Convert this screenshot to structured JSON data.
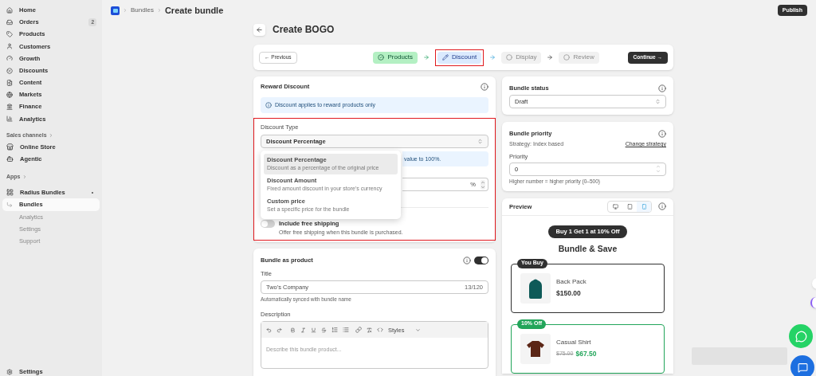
{
  "topbar": {
    "breadcrumb": [
      "Bundles",
      "Create bundle"
    ],
    "publish": "Publish"
  },
  "sidebar": {
    "nav": [
      {
        "label": "Home"
      },
      {
        "label": "Orders",
        "badge": "2"
      },
      {
        "label": "Products"
      },
      {
        "label": "Customers"
      },
      {
        "label": "Growth"
      },
      {
        "label": "Discounts"
      },
      {
        "label": "Content"
      },
      {
        "label": "Markets"
      },
      {
        "label": "Finance"
      },
      {
        "label": "Analytics"
      }
    ],
    "sales_channels": {
      "heading": "Sales channels",
      "items": [
        {
          "label": "Online Store"
        },
        {
          "label": "Agentic"
        }
      ]
    },
    "apps": {
      "heading": "Apps",
      "app": "Radius Bundles",
      "items": [
        {
          "label": "Bundles",
          "selected": true
        },
        {
          "label": "Analytics",
          "selected": false
        },
        {
          "label": "Settings",
          "selected": false
        },
        {
          "label": "Support",
          "selected": false
        }
      ]
    },
    "footer": "Settings"
  },
  "page": {
    "title": "Create BOGO",
    "previous": "← Previous",
    "continue": "Continue →",
    "steps": [
      {
        "label": "Products",
        "done": true,
        "selected": false
      },
      {
        "label": "Discount",
        "done": false,
        "selected": true
      },
      {
        "label": "Display",
        "done": false,
        "selected": false
      },
      {
        "label": "Review",
        "done": false,
        "selected": false
      }
    ]
  },
  "reward": {
    "title": "Reward Discount",
    "info": "Discount applies to reward products only",
    "type_label": "Discount Type",
    "type_value": "Discount Percentage",
    "hint_fragment": "value to 100%.",
    "unit": "%",
    "shipping": {
      "label": "Include free shipping",
      "description": "Offer free shipping when this bundle is purchased.",
      "on": false
    },
    "options": [
      {
        "title": "Discount Percentage",
        "description": "Discount as a percentage of the original price",
        "selected": true
      },
      {
        "title": "Discount Amount",
        "description": "Fixed amount discount in your store's currency",
        "selected": false
      },
      {
        "title": "Custom price",
        "description": "Set a specific price for the bundle",
        "selected": false
      }
    ]
  },
  "bundle_product": {
    "title": "Bundle as product",
    "on": true,
    "field_label": "Title",
    "value": "Two's Company",
    "count": "13/120",
    "help": "Automatically synced with bundle name",
    "description_label": "Description",
    "styles": "Styles",
    "placeholder": "Describe this bundle product..."
  },
  "status": {
    "title": "Bundle status",
    "value": "Draft"
  },
  "priority": {
    "title": "Bundle priority",
    "strategy": "Strategy: Index based",
    "change": "Change strategy",
    "label": "Priority",
    "value": "0",
    "help": "Higher number = higher priority (0–500)"
  },
  "preview": {
    "title": "Preview",
    "devices": [
      {
        "selected": false
      },
      {
        "selected": false
      },
      {
        "selected": true
      }
    ],
    "offer": "Buy 1 Get 1 at 10% Off",
    "heading": "Bundle & Save",
    "products": [
      {
        "kind": "buy",
        "tag": "You Buy",
        "name": "Back Pack",
        "price": "$150.00"
      },
      {
        "kind": "reward",
        "tag": "10% Off",
        "name": "Casual Shirt",
        "compare_price": "$75.00",
        "price": "$67.50"
      }
    ]
  }
}
